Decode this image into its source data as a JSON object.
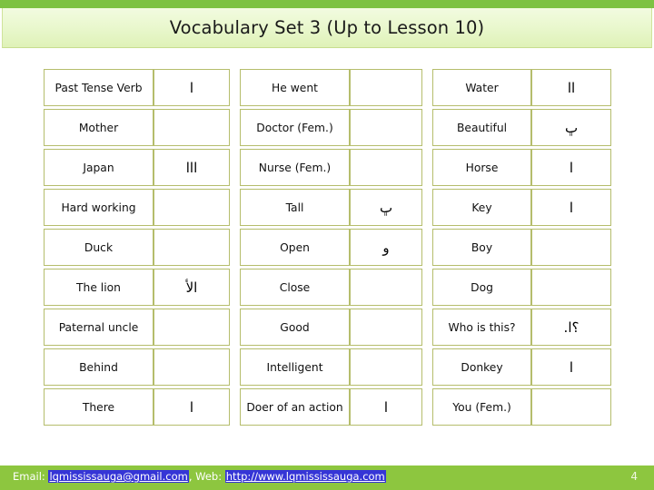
{
  "slide": {
    "title": "Vocabulary Set 3 (Up to Lesson 10)",
    "page_number": "4",
    "accent_green": "#8dc63f",
    "banner_green": "#7dc242",
    "table_border": "#b5bd6c"
  },
  "footer": {
    "email_label": "Email:",
    "email": "lqmississauga@gmail.com",
    "separator": ",",
    "web_label": "Web:",
    "web": "http://www.lqmississauga.com"
  },
  "table": {
    "columns": 3,
    "rows_per_column": 9,
    "groups": [
      {
        "name": "column-1",
        "rows": [
          {
            "english": "Past Tense Verb",
            "arabic": "ا"
          },
          {
            "english": "Mother",
            "arabic": ""
          },
          {
            "english": "Japan",
            "arabic": "ااا"
          },
          {
            "english": "Hard working",
            "arabic": ""
          },
          {
            "english": "Duck",
            "arabic": ""
          },
          {
            "english": "The lion",
            "arabic": "الأ"
          },
          {
            "english": "Paternal uncle",
            "arabic": ""
          },
          {
            "english": "Behind",
            "arabic": ""
          },
          {
            "english": "There",
            "arabic": "ا"
          }
        ]
      },
      {
        "name": "column-2",
        "rows": [
          {
            "english": "He went",
            "arabic": ""
          },
          {
            "english": "Doctor (Fem.)",
            "arabic": ""
          },
          {
            "english": "Nurse (Fem.)",
            "arabic": ""
          },
          {
            "english": "Tall",
            "arabic": "ڀ"
          },
          {
            "english": "Open",
            "arabic": "و"
          },
          {
            "english": "Close",
            "arabic": ""
          },
          {
            "english": "Good",
            "arabic": ""
          },
          {
            "english": "Intelligent",
            "arabic": ""
          },
          {
            "english": "Doer of an action",
            "arabic": "ا"
          }
        ]
      },
      {
        "name": "column-3",
        "rows": [
          {
            "english": "Water",
            "arabic": "اا"
          },
          {
            "english": "Beautiful",
            "arabic": "ڀ"
          },
          {
            "english": "Horse",
            "arabic": "ا"
          },
          {
            "english": "Key",
            "arabic": "ا"
          },
          {
            "english": "Boy",
            "arabic": ""
          },
          {
            "english": "Dog",
            "arabic": ""
          },
          {
            "english": "Who is this?",
            "arabic": "؟ا."
          },
          {
            "english": "Donkey",
            "arabic": "ا"
          },
          {
            "english": "You (Fem.)",
            "arabic": ""
          }
        ]
      }
    ]
  }
}
